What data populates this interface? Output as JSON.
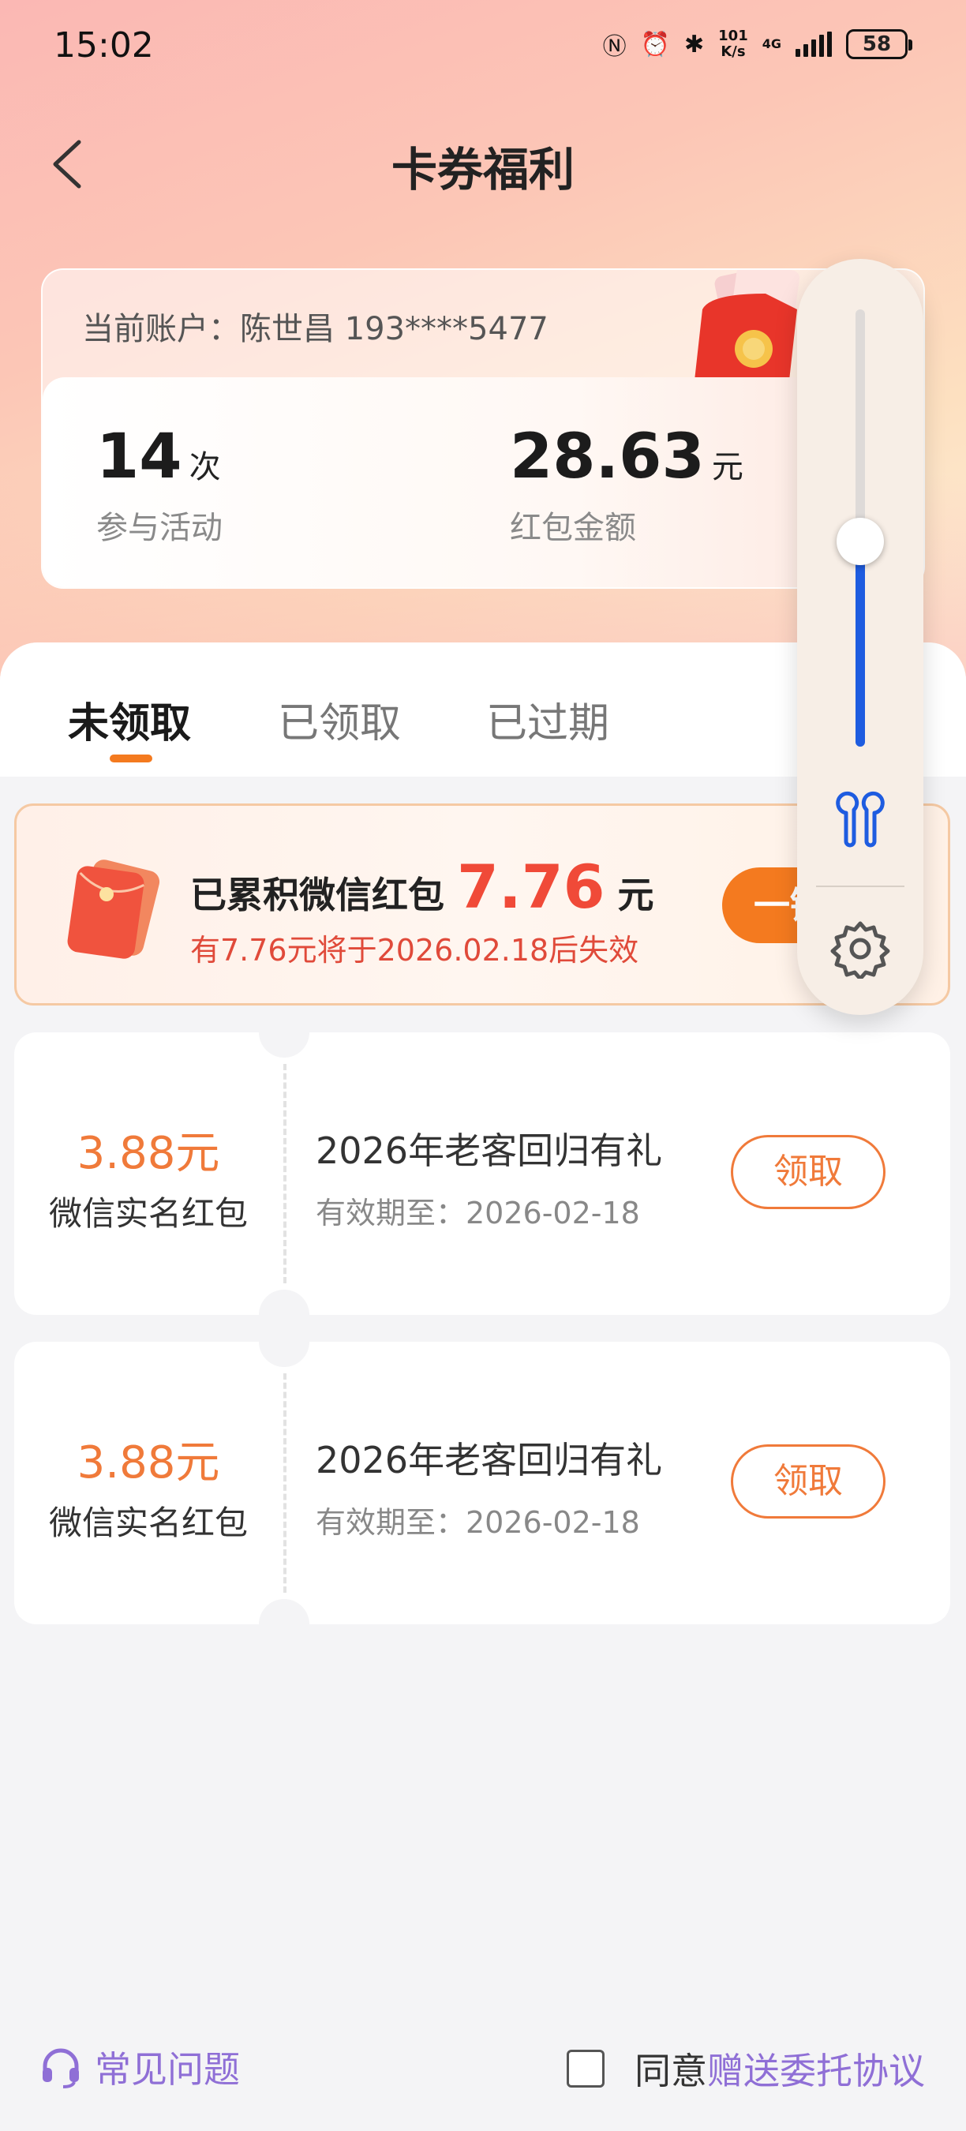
{
  "status_bar": {
    "time": "15:02",
    "net_speed_top": "101",
    "net_speed_bottom": "K/s",
    "network_type": "4G",
    "battery": "58"
  },
  "header": {
    "title": "卡券福利",
    "back_icon": "chevron-left-icon"
  },
  "account": {
    "label": "当前账户：陈世昌 193****5477",
    "participation_count": "14",
    "participation_unit": "次",
    "participation_label": "参与活动",
    "red_packet_amount": "28.63",
    "red_packet_unit": "元",
    "red_packet_label": "红包金额"
  },
  "tabs": [
    {
      "label": "未领取",
      "active": true
    },
    {
      "label": "已领取",
      "active": false
    },
    {
      "label": "已过期",
      "active": false
    }
  ],
  "accumulated": {
    "title_prefix": "已累积微信红包",
    "amount": "7.76",
    "unit": "元",
    "expiry_notice": "有7.76元将于2026.02.18后失效",
    "button_label": "一键"
  },
  "coupons": [
    {
      "amount": "3.88元",
      "type": "微信实名红包",
      "title": "2026年老客回归有礼",
      "valid_until": "有效期至：2026-02-18",
      "button": "领取"
    },
    {
      "amount": "3.88元",
      "type": "微信实名红包",
      "title": "2026年老客回归有礼",
      "valid_until": "有效期至：2026-02-18",
      "button": "领取"
    }
  ],
  "footer": {
    "faq_label": "常见问题",
    "agree_prefix": "同意",
    "agree_link": "赠送委托协议",
    "checkbox_checked": false
  },
  "volume_overlay": {
    "level_fraction": 0.47,
    "icons": [
      "earbuds-icon",
      "gear-icon"
    ]
  },
  "colors": {
    "accent_orange": "#f47a1f",
    "red_amount": "#f04a38",
    "volume_blue": "#1e5ce0",
    "link_purple": "#8f6fd6"
  }
}
